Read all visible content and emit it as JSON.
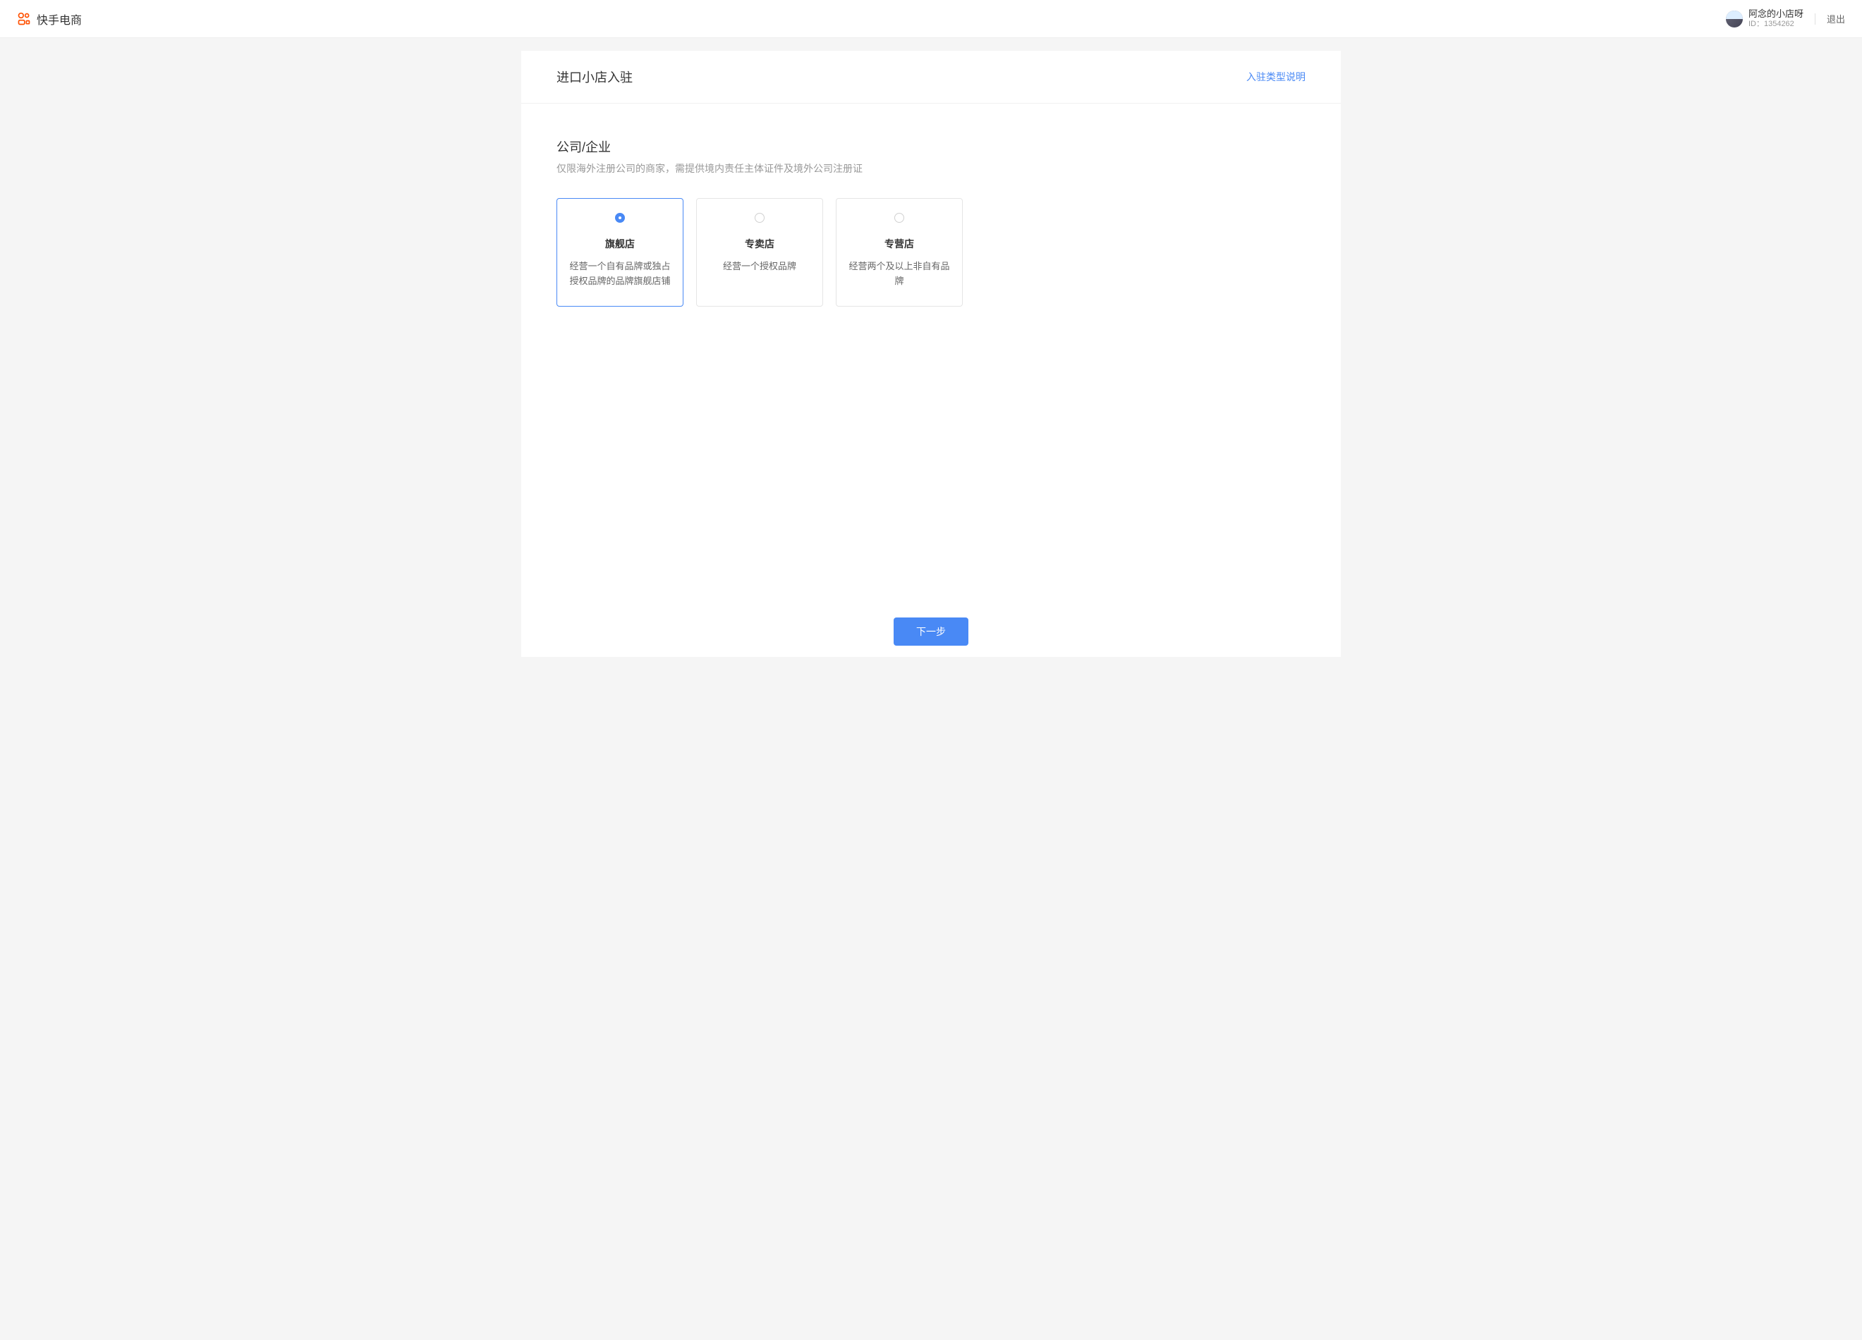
{
  "header": {
    "logo_text": "快手电商",
    "user_name": "阿念的小店呀",
    "user_id_prefix": "ID：",
    "user_id": "1354262",
    "logout_label": "退出"
  },
  "page": {
    "title": "进口小店入驻",
    "help_link": "入驻类型说明"
  },
  "section": {
    "title": "公司/企业",
    "desc": "仅限海外注册公司的商家，需提供境内责任主体证件及境外公司注册证"
  },
  "options": [
    {
      "title": "旗舰店",
      "desc": "经营一个自有品牌或独占授权品牌的品牌旗舰店铺",
      "selected": true
    },
    {
      "title": "专卖店",
      "desc": "经营一个授权品牌",
      "selected": false
    },
    {
      "title": "专营店",
      "desc": "经营两个及以上非自有品牌",
      "selected": false
    }
  ],
  "footer": {
    "next_label": "下一步"
  }
}
